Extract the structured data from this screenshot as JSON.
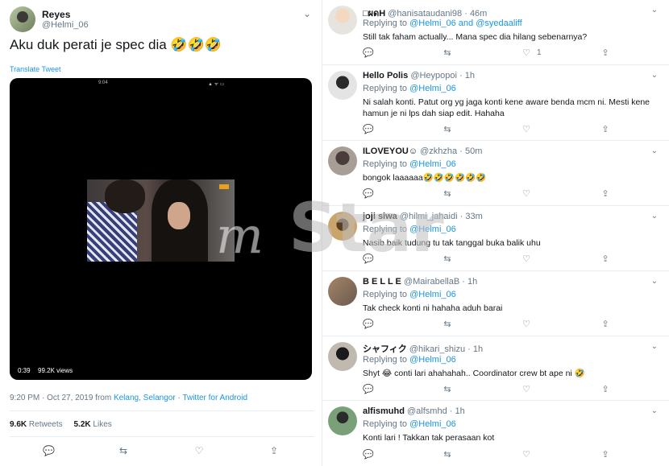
{
  "main_tweet": {
    "name": "Reyes",
    "handle": "@Helmi_06",
    "text": "Aku duk perati je spec dia 🤣🤣🤣",
    "translate": "Translate Tweet",
    "video": {
      "status_time": "9:04",
      "status_icons": "▲ ᯤ ▭",
      "duration": "0:39",
      "views": "99.2K views"
    },
    "timestamp": "9:20 PM · Oct 27, 2019 from",
    "location": "Kelang, Selangor",
    "separator": "·",
    "source": "Twitter for Android",
    "retweets_count": "9.6K",
    "retweets_label": "Retweets",
    "likes_count": "5.2K",
    "likes_label": "Likes"
  },
  "icons": {
    "chevron": "⌄",
    "reply": "💬",
    "retweet": "⇆",
    "like": "♡",
    "share": "⇪"
  },
  "replies": [
    {
      "name": "□ผดH",
      "handle": "@hanisataudani98",
      "time": "· 46m",
      "replying_prefix": "Replying to",
      "replying_to": "@Helmi_06 and @syedaaliff",
      "text": "Still tak faham actually... Mana spec dia hilang sebenarnya?",
      "like_count": "1"
    },
    {
      "name": "Hello Polis",
      "handle": "@Heypopoi",
      "time": "· 1h",
      "replying_prefix": "Replying to",
      "replying_to": "@Helmi_06",
      "text": "Ni salah konti. Patut org yg jaga konti kene aware benda mcm ni. Mesti kene hamun je ni lps dah siap edit.  Hahaha",
      "like_count": ""
    },
    {
      "name": "ILOVEYOU☺",
      "handle": "@zkhzha",
      "time": "· 50m",
      "replying_prefix": "Replying to",
      "replying_to": "@Helmi_06",
      "text": "bongok laaaaaa🤣🤣🤣🤣🤣🤣",
      "like_count": ""
    },
    {
      "name": "joji siwa",
      "handle": "@hilmi_jahaidi",
      "time": "· 33m",
      "replying_prefix": "Replying to",
      "replying_to": "@Helmi_06",
      "text": "Nasib baik tudung tu tak tanggal buka balik uhu",
      "like_count": ""
    },
    {
      "name": "B E L L E",
      "handle": "@MairabellaB",
      "time": "· 1h",
      "replying_prefix": "Replying to",
      "replying_to": "@Helmi_06",
      "text": "Tak check konti ni hahaha aduh barai",
      "like_count": ""
    },
    {
      "name": "シャフィク",
      "handle": "@hikari_shizu",
      "time": "· 1h",
      "replying_prefix": "Replying to",
      "replying_to": "@Helmi_06",
      "text": "Shyt 😂 conti lari ahahahah.. Coordinator crew bt ape ni 🤣",
      "like_count": ""
    },
    {
      "name": "alfismuhd",
      "handle": "@alfsmhd",
      "time": "· 1h",
      "replying_prefix": "Replying to",
      "replying_to": "@Helmi_06",
      "text": "Konti lari ! Takkan tak perasaan kot",
      "like_count": ""
    }
  ],
  "watermark": {
    "prefix": "m",
    "brand": "Star"
  }
}
